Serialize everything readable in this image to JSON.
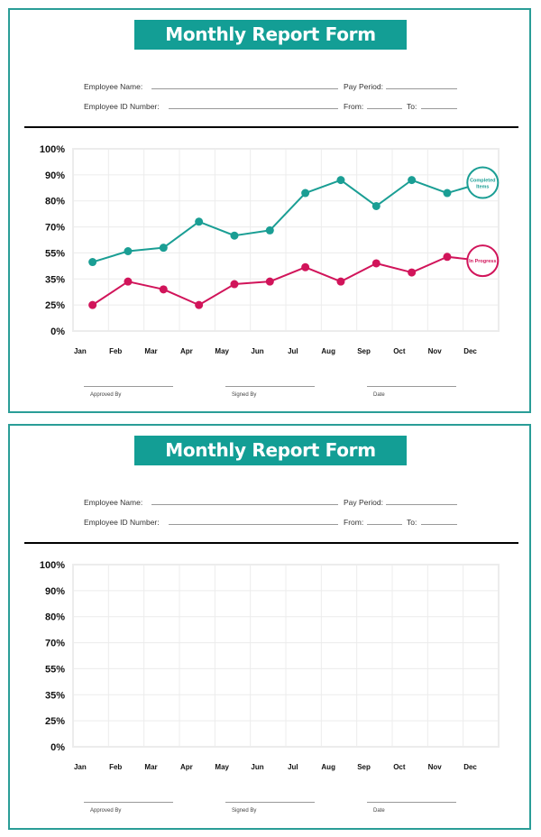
{
  "forms": [
    {
      "title": "Monthly Report Form",
      "fields": {
        "employee_name_label": "Employee Name:",
        "employee_name_value": "",
        "pay_period_label": "Pay Period:",
        "pay_period_value": "",
        "employee_id_label": "Employee ID Number:",
        "employee_id_value": "",
        "from_label": "From:",
        "from_value": "",
        "to_label": "To:",
        "to_value": ""
      },
      "signatures": {
        "approved_by": "Approved By",
        "signed_by": "Signed By",
        "date": "Date"
      }
    },
    {
      "title": "Monthly Report Form",
      "fields": {
        "employee_name_label": "Employee Name:",
        "employee_name_value": "",
        "pay_period_label": "Pay Period:",
        "pay_period_value": "",
        "employee_id_label": "Employee ID Number:",
        "employee_id_value": "",
        "from_label": "From:",
        "from_value": "",
        "to_label": "To:",
        "to_value": ""
      },
      "signatures": {
        "approved_by": "Approved By",
        "signed_by": "Signed By",
        "date": "Date"
      }
    }
  ],
  "colors": {
    "accent": "#139e95",
    "completed": "#1a9e94",
    "in_progress": "#d1145a",
    "border": "#2a9d97",
    "grid": "#ececec"
  },
  "chart_data": [
    {
      "type": "line",
      "title": "",
      "xlabel": "",
      "ylabel": "",
      "categories": [
        "Jan",
        "Feb",
        "Mar",
        "Apr",
        "May",
        "Jun",
        "Jul",
        "Aug",
        "Sep",
        "Oct",
        "Nov",
        "Dec"
      ],
      "y_tick_labels": [
        "0%",
        "25%",
        "35%",
        "55%",
        "70%",
        "80%",
        "90%",
        "100%"
      ],
      "y_tick_values": [
        0,
        25,
        35,
        55,
        70,
        80,
        90,
        100
      ],
      "ylim": [
        0,
        100
      ],
      "grid": true,
      "series": [
        {
          "name": "Completed Items",
          "color": "#1a9e94",
          "values": [
            48,
            56,
            58,
            72,
            65,
            68,
            83,
            88,
            78,
            88,
            83,
            87
          ]
        },
        {
          "name": "In Progress",
          "color": "#d1145a",
          "values": [
            25,
            34,
            31,
            25,
            33,
            34,
            44,
            34,
            47,
            40,
            52,
            49
          ]
        }
      ],
      "legend": "end-of-line circle labels"
    },
    {
      "type": "line",
      "title": "",
      "xlabel": "",
      "ylabel": "",
      "categories": [
        "Jan",
        "Feb",
        "Mar",
        "Apr",
        "May",
        "Jun",
        "Jul",
        "Aug",
        "Sep",
        "Oct",
        "Nov",
        "Dec"
      ],
      "y_tick_labels": [
        "0%",
        "25%",
        "35%",
        "55%",
        "70%",
        "80%",
        "90%",
        "100%"
      ],
      "y_tick_values": [
        0,
        25,
        35,
        55,
        70,
        80,
        90,
        100
      ],
      "ylim": [
        0,
        100
      ],
      "grid": true,
      "series": []
    }
  ]
}
